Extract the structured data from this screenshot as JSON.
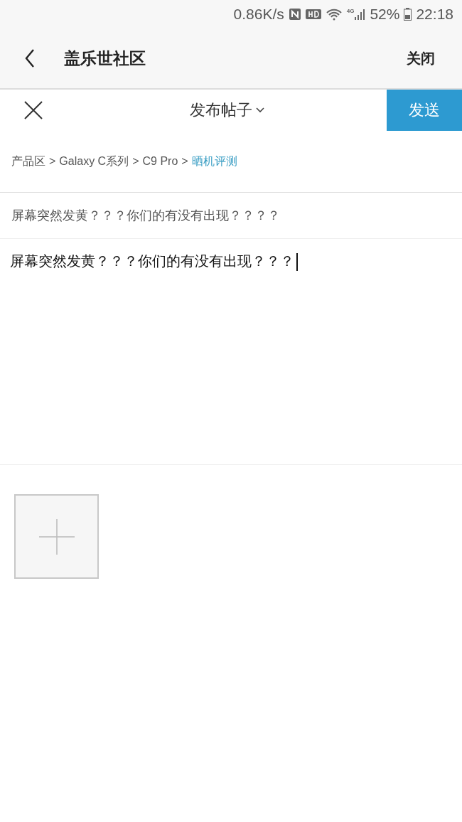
{
  "status_bar": {
    "speed": "0.86K/s",
    "network": "4G",
    "battery": "52%",
    "time": "22:18"
  },
  "app_bar": {
    "title": "盖乐世社区",
    "close": "关闭"
  },
  "editor_toolbar": {
    "title": "发布帖子",
    "send": "发送"
  },
  "breadcrumb": {
    "separator": ">",
    "items": [
      {
        "label": "产品区",
        "selected": false
      },
      {
        "label": "Galaxy C系列",
        "selected": false
      },
      {
        "label": "C9 Pro",
        "selected": false
      },
      {
        "label": "晒机评测",
        "selected": true
      }
    ]
  },
  "title_field": {
    "value": "屏幕突然发黄？？？你们的有没有出现？？？？"
  },
  "content_field": {
    "value": "屏幕突然发黄？？？你们的有没有出现？？？"
  }
}
